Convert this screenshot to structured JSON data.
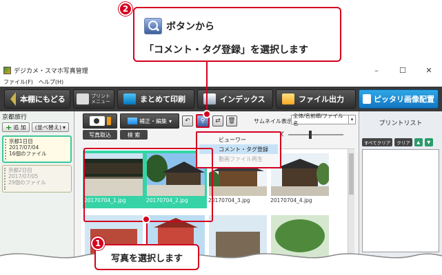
{
  "callout2": {
    "number": "2",
    "line1": "ボタンから",
    "line2": "「コメント・タグ登録」を選択します",
    "icon": "lens-button-icon"
  },
  "callout1": {
    "number": "1",
    "text": "写真を選択します"
  },
  "window": {
    "title": "デジカメ・スマホ写真管理",
    "controls": [
      "–",
      "☐",
      "✕"
    ],
    "menu": [
      "ファイル(F)",
      "ヘルプ(H)"
    ]
  },
  "toolbar": {
    "back_label": "本棚にもどる",
    "print_menu_top": "プリント",
    "print_menu_bottom": "メニュー",
    "batch_print": "まとめて印刷",
    "index": "インデックス",
    "file_output": "ファイル出力",
    "fit_layout": "ピッタリ画像配置"
  },
  "left_panel": {
    "album_title": "京都旅行",
    "add_label": "追 加",
    "sort_label": "(並べ替え)",
    "folders": [
      {
        "name": "京都1日目",
        "date": "2017/07/04",
        "count": "16個のファイル"
      },
      {
        "name": "京都2日目",
        "date": "2017/07/05",
        "count": "29個のファイル"
      }
    ]
  },
  "main_toolbar": {
    "edit_label": "補正・編集",
    "import_label": "写真取込",
    "search_label": "検 索",
    "thumb_size_label": "サムネイル表示",
    "sort_value": "全体/名前順/ファイル名",
    "size_suffix": "ズ"
  },
  "dropdown": {
    "items": [
      "ビューワー",
      "コメント・タグ登録",
      "動画ファイル再生"
    ]
  },
  "thumbnails": [
    {
      "name": "20170704_1.jpg",
      "selected": true
    },
    {
      "name": "20170704_2.jpg",
      "selected": true
    },
    {
      "name": "20170704_3.jpg",
      "selected": false
    },
    {
      "name": "20170704_4.jpg",
      "selected": false
    }
  ],
  "right_panel": {
    "title": "プリントリスト",
    "select_all": "すべてクリア",
    "clear": "クリア"
  },
  "colors": {
    "accent_red": "#d4001f",
    "selection_teal": "#35d3a6",
    "toolbar_dark": "#3a3a3a",
    "highlight_blue": "#1f8ed6"
  }
}
